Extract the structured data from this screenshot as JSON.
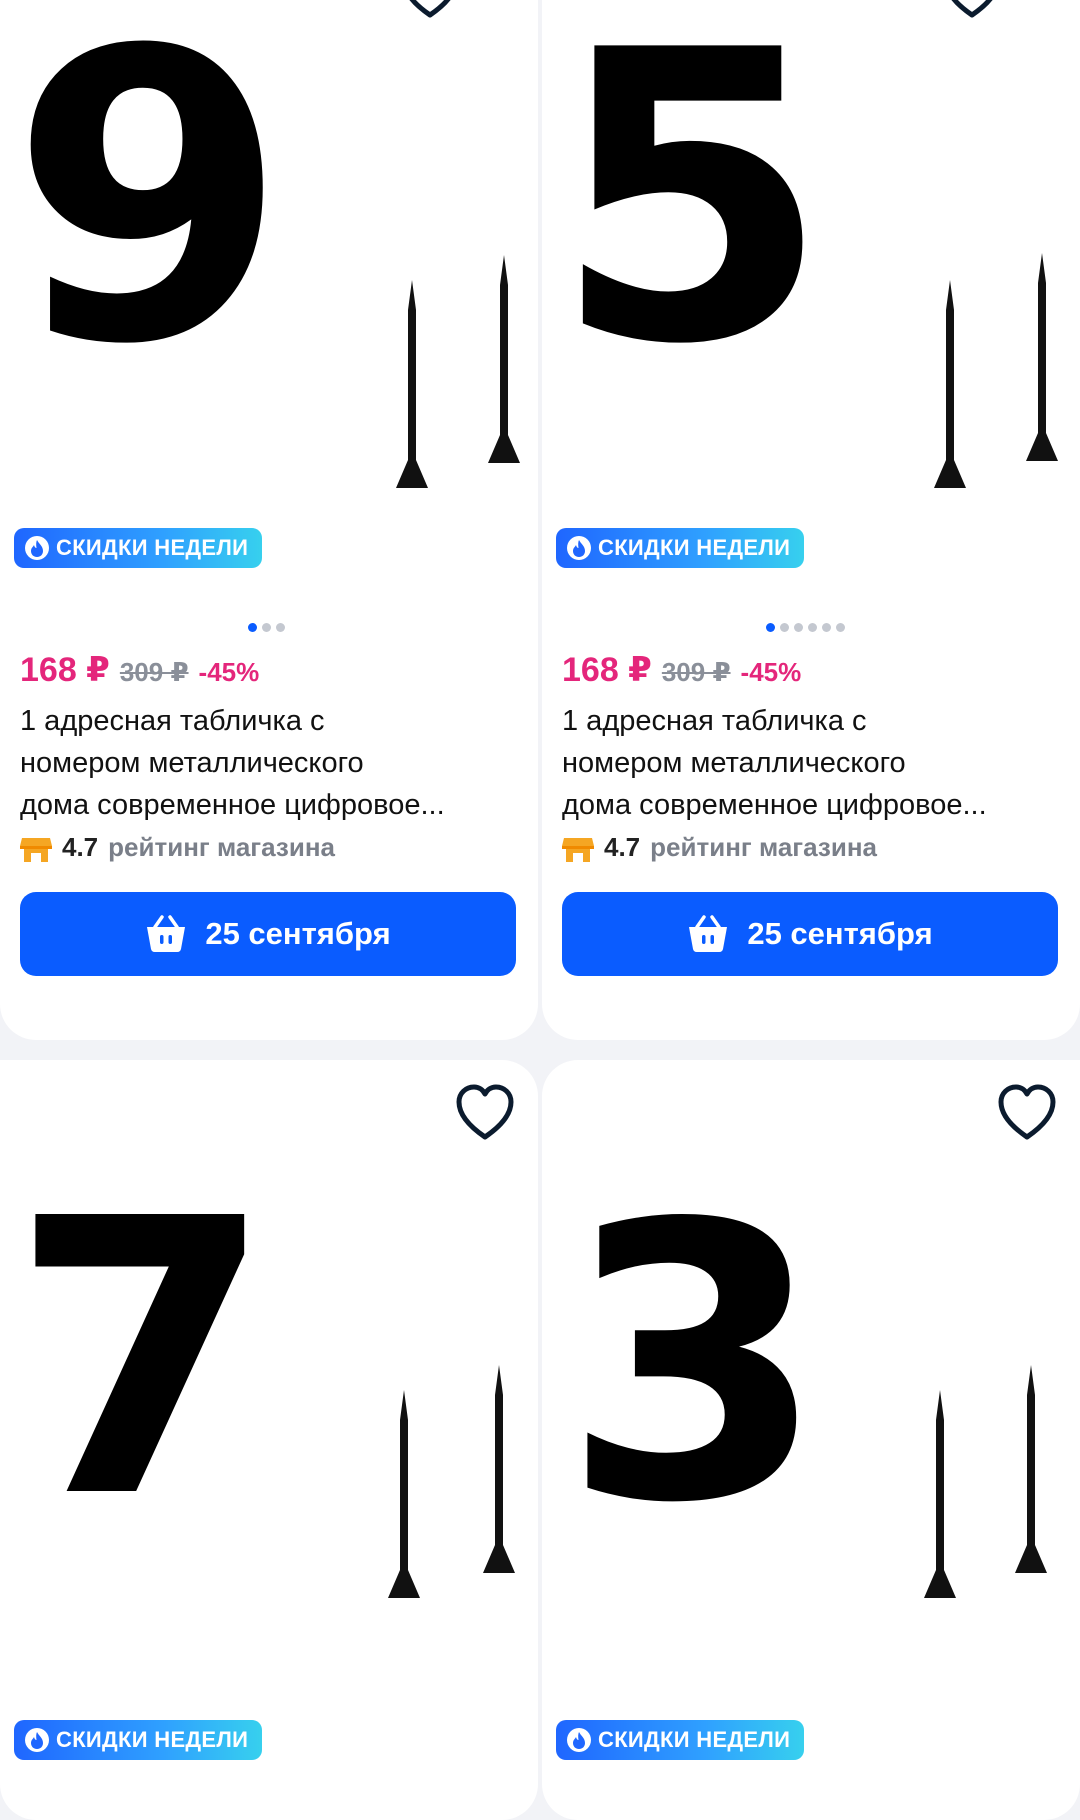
{
  "products": [
    {
      "digit": "9",
      "badge": "СКИДКИ НЕДЕЛИ",
      "dots_total": 3,
      "dots_active": 0,
      "price": "168 ₽",
      "old_price": "309 ₽",
      "discount": "-45%",
      "title_line1": "1 адресная табличка с",
      "title_line2": "номером металлического",
      "title_line3": "дома современное цифровое...",
      "rating_value": "4.7",
      "rating_label": "рейтинг магазина",
      "delivery": "25 сентября"
    },
    {
      "digit": "5",
      "badge": "СКИДКИ НЕДЕЛИ",
      "dots_total": 6,
      "dots_active": 0,
      "price": "168 ₽",
      "old_price": "309 ₽",
      "discount": "-45%",
      "title_line1": "1 адресная табличка с",
      "title_line2": "номером металлического",
      "title_line3": "дома современное цифровое...",
      "rating_value": "4.7",
      "rating_label": "рейтинг магазина",
      "delivery": "25 сентября"
    },
    {
      "digit": "7",
      "badge": "СКИДКИ НЕДЕЛИ"
    },
    {
      "digit": "3",
      "badge": "СКИДКИ НЕДЕЛИ"
    }
  ],
  "colors": {
    "accent": "#0a5cff",
    "price": "#e4267b",
    "muted": "#8a8f99"
  },
  "icons": {
    "favorite": "heart-outline-icon",
    "badge": "fire-icon",
    "shop": "shop-icon",
    "cart": "cart-icon"
  }
}
